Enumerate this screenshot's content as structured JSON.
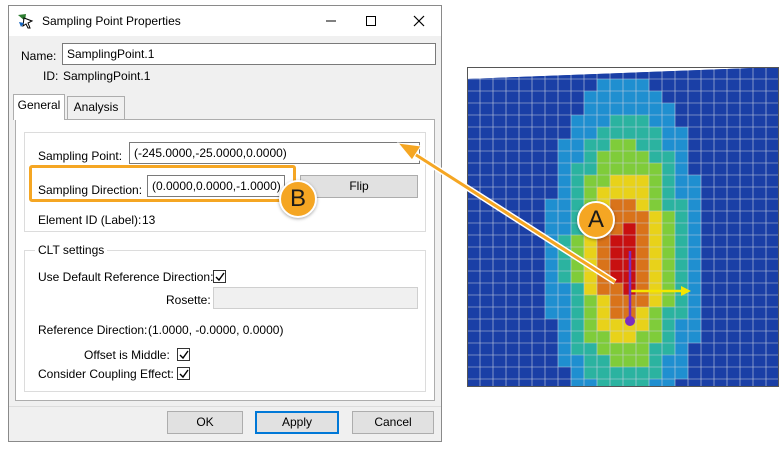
{
  "window": {
    "title": "Sampling Point Properties",
    "icons": {
      "app": "sampling-point-icon",
      "minimize": "minimize-icon",
      "maximize": "maximize-icon",
      "close": "close-icon"
    }
  },
  "name_label": "Name:",
  "name_value": "SamplingPoint.1",
  "id_label": "ID:",
  "id_value": "SamplingPoint.1",
  "tabs": [
    {
      "label": "General",
      "active": true
    },
    {
      "label": "Analysis",
      "active": false
    }
  ],
  "general": {
    "sampling_point_label": "Sampling Point:",
    "sampling_point_value": "(-245.0000,-25.0000,0.0000)",
    "sampling_direction_label": "Sampling Direction:",
    "sampling_direction_value": "(0.0000,0.0000,-1.0000)",
    "flip_label": "Flip",
    "element_id_label": "Element ID (Label):",
    "element_id_value": "13"
  },
  "clt": {
    "group_title": "CLT settings",
    "use_default_label": "Use Default Reference Direction:",
    "use_default_checked": true,
    "rosette_label": "Rosette:",
    "rosette_value": "",
    "reference_direction_label": "Reference Direction:",
    "reference_direction_value": "(1.0000, -0.0000, 0.0000)",
    "offset_middle_label": "Offset is Middle:",
    "offset_middle_checked": true,
    "coupling_label": "Consider Coupling Effect:",
    "coupling_checked": true
  },
  "footer": {
    "ok": "OK",
    "apply": "Apply",
    "cancel": "Cancel"
  },
  "callouts": {
    "a": "A",
    "b": "B"
  },
  "colors": {
    "callout": "#f5a623",
    "accent": "#0078d7",
    "arrow": "#f5a623"
  }
}
